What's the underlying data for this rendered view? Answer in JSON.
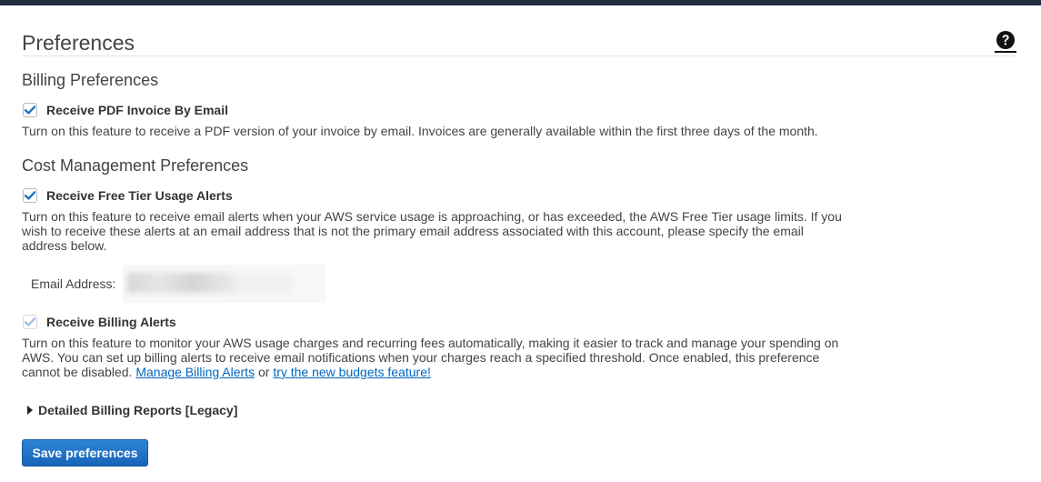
{
  "page": {
    "title": "Preferences",
    "help_icon": "question-circle-icon"
  },
  "billing": {
    "heading": "Billing Preferences",
    "pdf_invoice": {
      "label": "Receive PDF Invoice By Email",
      "checked": true,
      "description": "Turn on this feature to receive a PDF version of your invoice by email. Invoices are generally available within the first three days of the month."
    }
  },
  "cost_management": {
    "heading": "Cost Management Preferences",
    "free_tier": {
      "label": "Receive Free Tier Usage Alerts",
      "checked": true,
      "description": "Turn on this feature to receive email alerts when your AWS service usage is approaching, or has exceeded, the AWS Free Tier usage limits. If you wish to receive these alerts at an email address that is not the primary email address associated with this account, please specify the email address below."
    },
    "email": {
      "label": "Email Address:",
      "value": "",
      "redacted": true
    },
    "billing_alerts": {
      "label": "Receive Billing Alerts",
      "checked": true,
      "disabled": true,
      "description": "Turn on this feature to monitor your AWS usage charges and recurring fees automatically, making it easier to track and manage your spending on AWS. You can set up billing alerts to receive email notifications when your charges reach a specified threshold. Once enabled, this preference cannot be disabled.",
      "link_manage": "Manage Billing Alerts",
      "link_or": "or",
      "link_budgets": "try the new budgets feature!"
    }
  },
  "legacy": {
    "label": "Detailed Billing Reports [Legacy]",
    "expanded": false
  },
  "actions": {
    "save_label": "Save preferences"
  },
  "colors": {
    "top_bar": "#232f3e",
    "checkbox_check": "#1a73c9",
    "checkbox_check_disabled": "#9cc3e6",
    "link": "#0066c0",
    "button_bg": "#1764b8"
  }
}
